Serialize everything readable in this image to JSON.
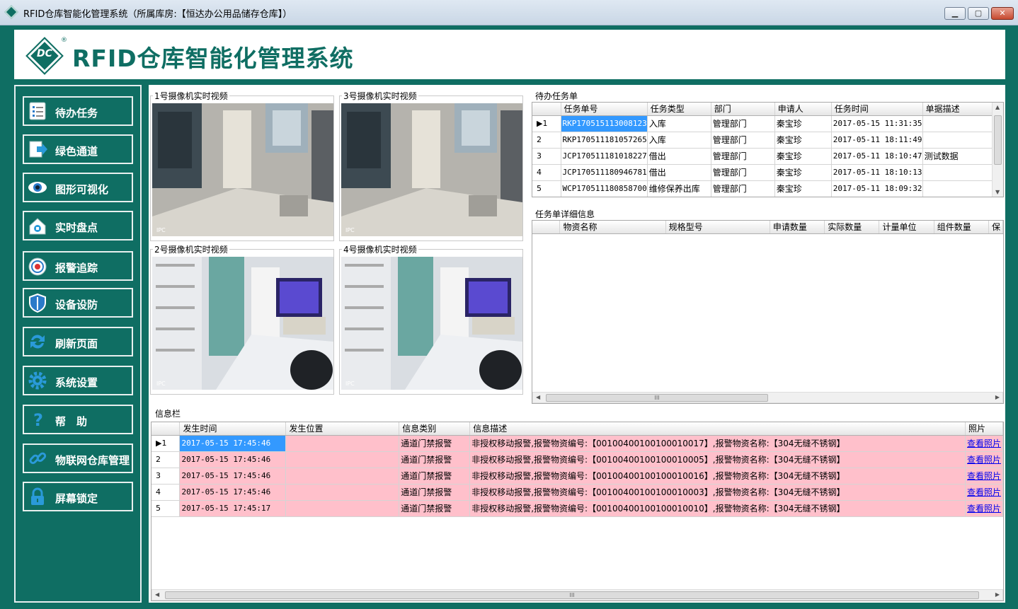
{
  "window": {
    "title": "RFID仓库智能化管理系统（所属库房:【恒达办公用品储存仓库】）",
    "minimize_label": "▁",
    "maximize_label": "▢",
    "close_label": "✕"
  },
  "header": {
    "logo_text": "DC",
    "logo_mark": "®",
    "app_title": "RFID仓库智能化管理系统"
  },
  "sidebar": {
    "items": [
      {
        "label": "待办任务",
        "icon": "task-list-icon"
      },
      {
        "label": "绿色通道",
        "icon": "green-channel-icon"
      },
      {
        "label": "图形可视化",
        "icon": "eye-icon"
      },
      {
        "label": "实时盘点",
        "icon": "home-inventory-icon"
      },
      {
        "label": "报警追踪",
        "icon": "alarm-icon"
      },
      {
        "label": "设备设防",
        "icon": "shield-icon"
      },
      {
        "label": "刷新页面",
        "icon": "refresh-icon"
      },
      {
        "label": "系统设置",
        "icon": "gear-icon"
      },
      {
        "label": "帮　助",
        "icon": "help-icon"
      },
      {
        "label": "物联网仓库管理",
        "icon": "link-icon"
      },
      {
        "label": "屏幕锁定",
        "icon": "lock-icon"
      }
    ]
  },
  "cameras": [
    {
      "caption": "1号摄像机实时视频"
    },
    {
      "caption": "3号摄像机实时视频"
    },
    {
      "caption": "2号摄像机实时视频"
    },
    {
      "caption": "4号摄像机实时视频"
    }
  ],
  "todo": {
    "caption": "待办任务单",
    "columns": [
      "任务单号",
      "任务类型",
      "部门",
      "申请人",
      "任务时间",
      "单据描述"
    ],
    "rows": [
      {
        "marker": "▶1",
        "cells": [
          "RKP170515113008123",
          "入库",
          "管理部门",
          "秦宝珍",
          "2017-05-15 11:31:35",
          ""
        ]
      },
      {
        "marker": "2",
        "cells": [
          "RKP170511181057265",
          "入库",
          "管理部门",
          "秦宝珍",
          "2017-05-11 18:11:49",
          ""
        ]
      },
      {
        "marker": "3",
        "cells": [
          "JCP170511181018227",
          "借出",
          "管理部门",
          "秦宝珍",
          "2017-05-11 18:10:47",
          "测试数据"
        ]
      },
      {
        "marker": "4",
        "cells": [
          "JCP170511180946781",
          "借出",
          "管理部门",
          "秦宝珍",
          "2017-05-11 18:10:13",
          ""
        ]
      },
      {
        "marker": "5",
        "cells": [
          "WCP170511180858700",
          "维修保养出库",
          "管理部门",
          "秦宝珍",
          "2017-05-11 18:09:32",
          ""
        ]
      }
    ]
  },
  "detail": {
    "caption": "任务单详细信息",
    "columns": [
      "物资名称",
      "规格型号",
      "申请数量",
      "实际数量",
      "计量单位",
      "组件数量",
      "保"
    ],
    "scroll_grip": "III"
  },
  "info": {
    "caption": "信息栏",
    "columns": [
      "发生时间",
      "发生位置",
      "信息类别",
      "信息描述",
      "照片"
    ],
    "rows": [
      {
        "marker": "▶1",
        "cells": [
          "2017-05-15 17:45:46",
          "",
          "通道门禁报警",
          "非授权移动报警,报警物资编号:【00100400100100010017】,报警物资名称:【304无缝不锈钢】",
          "查看照片"
        ]
      },
      {
        "marker": "2",
        "cells": [
          "2017-05-15 17:45:46",
          "",
          "通道门禁报警",
          "非授权移动报警,报警物资编号:【00100400100100010005】,报警物资名称:【304无缝不锈钢】",
          "查看照片"
        ]
      },
      {
        "marker": "3",
        "cells": [
          "2017-05-15 17:45:46",
          "",
          "通道门禁报警",
          "非授权移动报警,报警物资编号:【00100400100100010016】,报警物资名称:【304无缝不锈钢】",
          "查看照片"
        ]
      },
      {
        "marker": "4",
        "cells": [
          "2017-05-15 17:45:46",
          "",
          "通道门禁报警",
          "非授权移动报警,报警物资编号:【00100400100100010003】,报警物资名称:【304无缝不锈钢】",
          "查看照片"
        ]
      },
      {
        "marker": "5",
        "cells": [
          "2017-05-15 17:45:17",
          "",
          "通道门禁报警",
          "非授权移动报警,报警物资编号:【00100400100100010010】,报警物资名称:【304无缝不锈钢】",
          "查看照片"
        ]
      }
    ],
    "scroll_grip": "III"
  },
  "colors": {
    "brand": "#0f6e63",
    "alarm_row": "#ffc0cb",
    "selection": "#3399ff"
  }
}
